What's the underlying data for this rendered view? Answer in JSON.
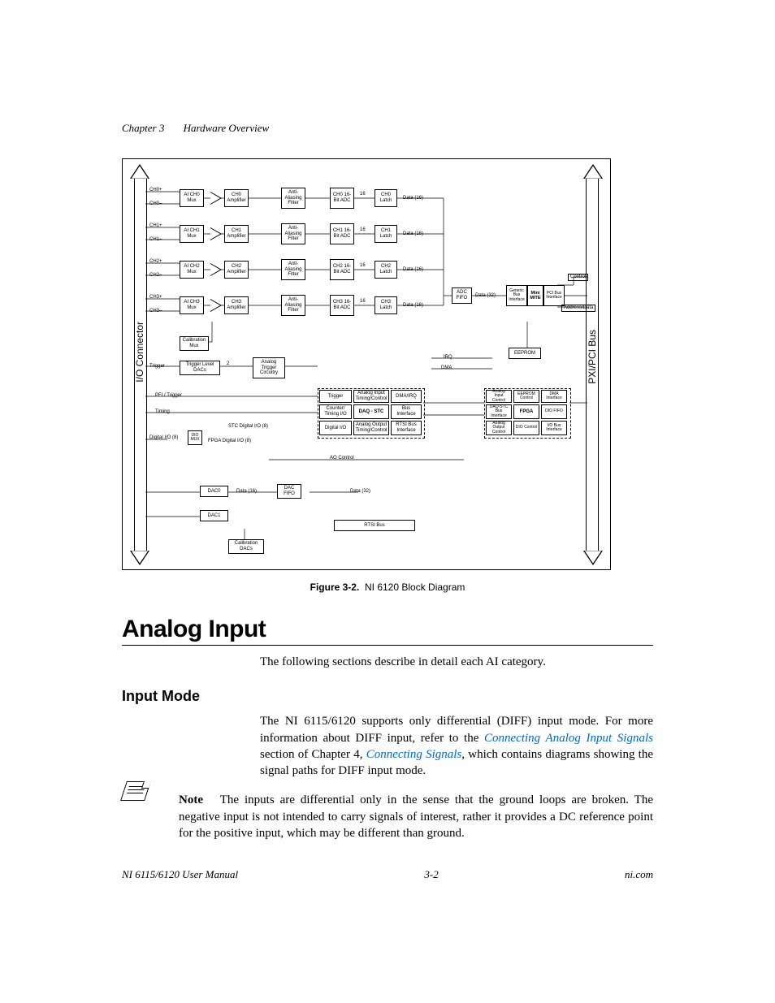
{
  "header": {
    "chapter": "Chapter 3",
    "title": "Hardware Overview"
  },
  "figure": {
    "caption_label": "Figure 3-2.",
    "caption_text": "NI 6120 Block Diagram",
    "io_label": "I/O Connector",
    "bus_label": "PXI/PCI Bus",
    "channels": [
      {
        "pos": "CH0+",
        "neg": "CH0–",
        "mux": "AI CH0\nMux",
        "amp": "CH0\nAmplifier",
        "filt": "Anti-\nAliasing\nFilter",
        "adc": "CH0\n16-Bit\nADC",
        "bits": "16",
        "latch": "CH0\nLatch",
        "data": "Data (16)"
      },
      {
        "pos": "CH1+",
        "neg": "CH1–",
        "mux": "AI CH1\nMux",
        "amp": "CH1\nAmplifier",
        "filt": "Anti-\nAliasing\nFilter",
        "adc": "CH1\n16-Bit\nADC",
        "bits": "16",
        "latch": "CH1\nLatch",
        "data": "Data (16)"
      },
      {
        "pos": "CH2+",
        "neg": "CH2–",
        "mux": "AI CH2\nMux",
        "amp": "CH2\nAmplifier",
        "filt": "Anti-\nAliasing\nFilter",
        "adc": "CH2\n16-Bit\nADC",
        "bits": "16",
        "latch": "CH2\nLatch",
        "data": "Data (16)"
      },
      {
        "pos": "CH3+",
        "neg": "CH3–",
        "mux": "AI CH3\nMux",
        "amp": "CH3\nAmplifier",
        "filt": "Anti-\nAliasing\nFilter",
        "adc": "CH3\n16-Bit\nADC",
        "bits": "16",
        "latch": "CH3\nLatch",
        "data": "Data (16)"
      }
    ],
    "cal_mux": "Calibration\nMux",
    "trigger_in": "Trigger",
    "trig_dacs": "Trigger Level\nDACs",
    "trig_2": "2",
    "atc": "Analog\nTrigger\nCircuitry",
    "pfi": "PFI / Trigger",
    "timing": "Timing",
    "stc_dio": "STC Digital I/O (8)",
    "fpga_dio": "FPGA Digital I/O (8)",
    "dio08": "Digital I/O (8)",
    "dio_mux": "DIO\nMUX",
    "adc_fifo": "ADC\nFIFO",
    "data32": "Data (32)",
    "eeprom": "EEPROM",
    "irq": "IRQ",
    "dma": "DMA",
    "daqstc_rows": [
      [
        "Trigger",
        "Analog Input\nTiming/Control",
        "DMA/IRQ"
      ],
      [
        "Counter/\nTiming I/O",
        "DAQ - STC",
        "Bus\nInterface"
      ],
      [
        "Digital I/O",
        "Analog Output\nTiming/Control",
        "RTSI Bus\nInterface"
      ]
    ],
    "fpga_rows": [
      [
        "Analog\nInput\nControl",
        "EEPROM\nControl",
        "DMA\nInterface"
      ],
      [
        "DAQ-STC\nBus\nInterface",
        "FPGA",
        "DIO\nFIFO"
      ],
      [
        "Analog\nOutput\nControl",
        "DIO\nControl",
        "I/O\nBus\nInterface"
      ]
    ],
    "mite": {
      "left": "Generic\nBus\nInterface",
      "mid": "Mini\nMITE",
      "right": "PCI\nBus\nInterface"
    },
    "control": "Control",
    "addrdata": "Address/Data",
    "ao_control": "AO Control",
    "dac0": "DAC0",
    "dac1": "DAC1",
    "dac_fifo": "DAC\nFIFO",
    "data16": "Data (16)",
    "data32b": "Data (32)",
    "rtsi": "RTSI Bus",
    "cal_dacs": "Calibration\nDACs"
  },
  "sections": {
    "h1": "Analog Input",
    "intro": "The following sections describe in detail each AI category.",
    "h2": "Input Mode",
    "p1a": "The NI 6115/6120 supports only differential (DIFF) input mode. For more information about DIFF input, refer to the ",
    "link1": "Connecting Analog Input Signals",
    "p1b": " section of Chapter 4, ",
    "link2": "Connecting Signals",
    "p1c": ", which contains diagrams showing the signal paths for DIFF input mode.",
    "note_label": "Note",
    "note": "The inputs are differential only in the sense that the ground loops are broken. The negative input is not intended to carry signals of interest, rather it provides a DC reference point for the positive input, which may be different than ground."
  },
  "footer": {
    "left": "NI 6115/6120 User Manual",
    "center": "3-2",
    "right": "ni.com"
  }
}
